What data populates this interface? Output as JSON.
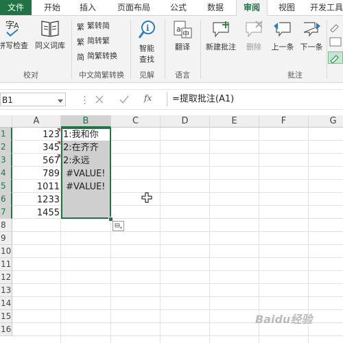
{
  "ribbon_tabs": [
    "文件",
    "开始",
    "插入",
    "页面布局",
    "公式",
    "数据",
    "审阅",
    "视图",
    "开发工具"
  ],
  "ribbon": {
    "spell_check": "拼写检查",
    "thesaurus": "同义词库",
    "proofing_group": "校对",
    "trad_to_simp": "繁转简",
    "simp_to_trad": "简转繁",
    "convert": "简繁转换",
    "chinese_group": "中文简繁转换",
    "smart_lookup_1": "智能",
    "smart_lookup_2": "查找",
    "insights_group": "见解",
    "translate": "翻译",
    "language_group": "语言",
    "new_comment": "新建批注",
    "delete": "删除",
    "previous": "上一条",
    "next": "下一条",
    "comments_group": "批注"
  },
  "formula_bar": {
    "name_box": "B1",
    "fx": "fx",
    "formula": "=提取批注(A1)"
  },
  "sheet": {
    "columns": [
      "A",
      "B",
      "C",
      "D",
      "E",
      "F",
      "G"
    ],
    "rows": [
      "1",
      "2",
      "3",
      "4",
      "5",
      "6",
      "7",
      "8",
      "9",
      "10",
      "11",
      "12",
      "13",
      "14",
      "15",
      "16"
    ],
    "col_a": [
      "123",
      "345",
      "567",
      "789",
      "1011",
      "1233",
      "1455"
    ],
    "col_b": [
      "1:我和你",
      "2:在齐齐",
      "2:永远",
      " #VALUE!",
      " #VALUE!",
      "",
      ""
    ]
  },
  "watermark": "Baidu经验"
}
